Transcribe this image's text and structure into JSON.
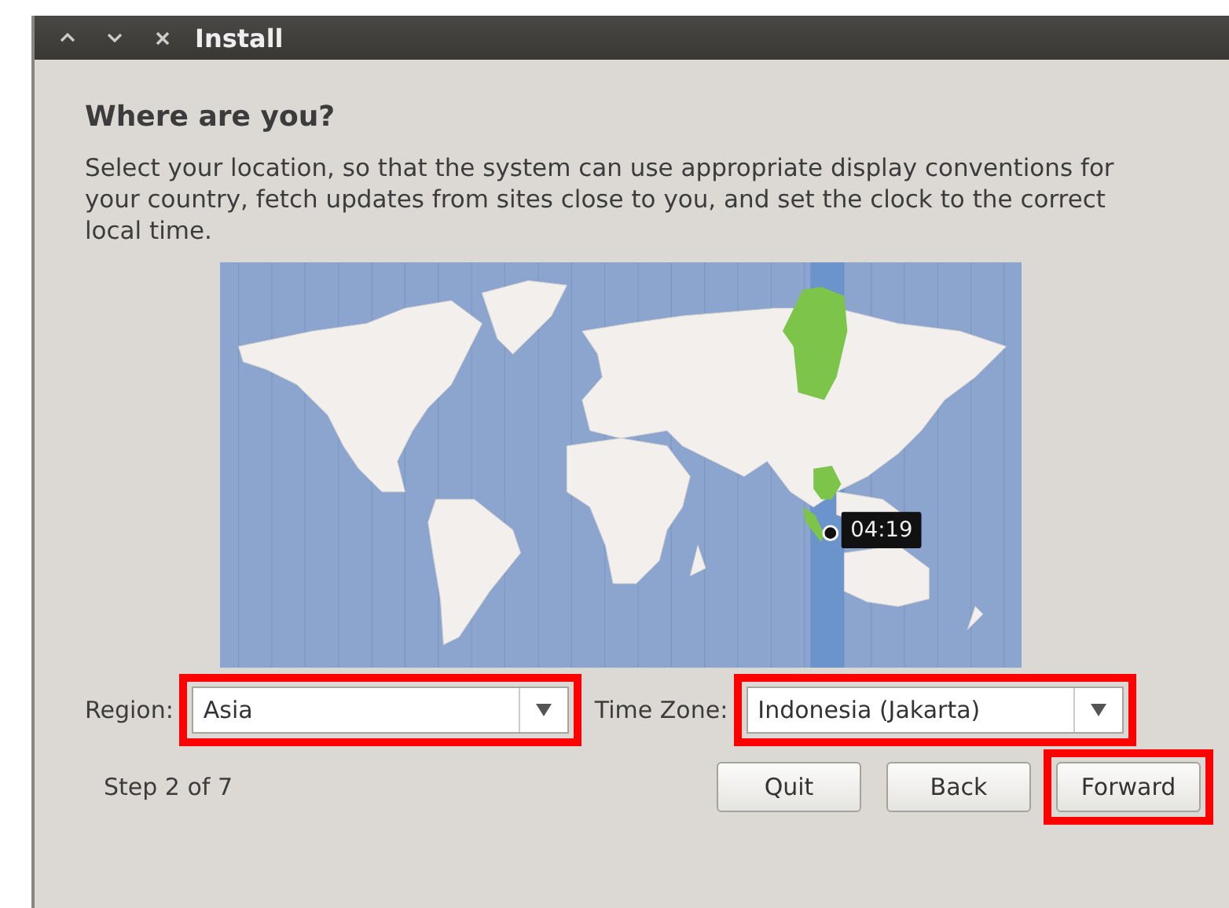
{
  "window": {
    "title": "Install"
  },
  "heading": "Where are you?",
  "description": "Select your location, so that the system can use appropriate display conventions for your country, fetch updates from sites close to you, and set the clock to the correct local time.",
  "map": {
    "time": "04:19"
  },
  "fields": [
    {
      "label": "Region:",
      "value": "Asia",
      "highlighted": true
    },
    {
      "label": "Time Zone:",
      "value": "Indonesia (Jakarta)",
      "highlighted": true
    }
  ],
  "step": "Step 2 of 7",
  "buttons": [
    {
      "label": "Quit",
      "highlighted": false
    },
    {
      "label": "Back",
      "highlighted": false
    },
    {
      "label": "Forward",
      "highlighted": true
    }
  ]
}
